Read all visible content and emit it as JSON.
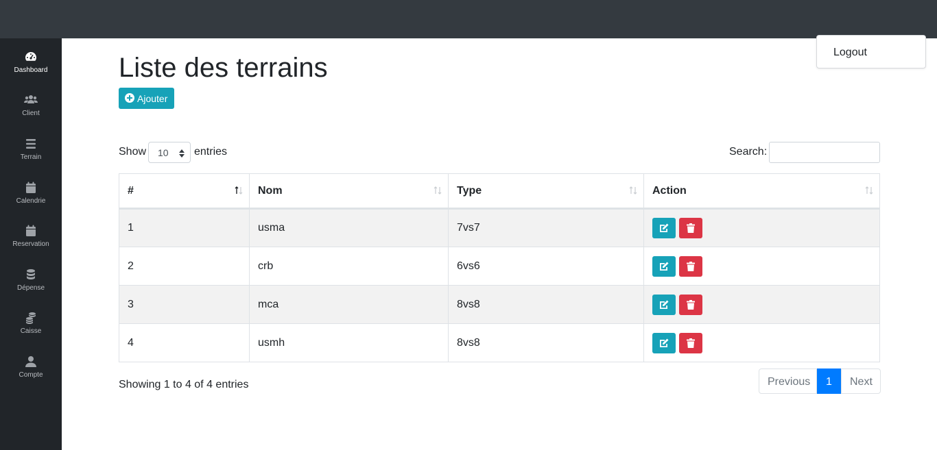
{
  "sidebar": {
    "items": [
      {
        "label": "Dashboard",
        "icon": "dashboard-icon"
      },
      {
        "label": "Client",
        "icon": "users-icon"
      },
      {
        "label": "Terrain",
        "icon": "bars-icon"
      },
      {
        "label": "Calendrie",
        "icon": "calendar-icon"
      },
      {
        "label": "Reservation",
        "icon": "calendar-icon"
      },
      {
        "label": "Dépense",
        "icon": "database-icon"
      },
      {
        "label": "Caisse",
        "icon": "coins-icon"
      },
      {
        "label": "Compte",
        "icon": "user-icon"
      }
    ]
  },
  "header": {
    "logout_label": "Logout"
  },
  "main": {
    "title": "Liste des terrains",
    "add_button_label": "Ajouter"
  },
  "table_controls": {
    "show_label": "Show",
    "page_length": "10",
    "entries_label": "entries",
    "search_label": "Search:",
    "search_value": ""
  },
  "table": {
    "columns": [
      "#",
      "Nom",
      "Type",
      "Action"
    ],
    "rows": [
      {
        "id": "1",
        "nom": "usma",
        "type": "7vs7"
      },
      {
        "id": "2",
        "nom": "crb",
        "type": "6vs6"
      },
      {
        "id": "3",
        "nom": "mca",
        "type": "8vs8"
      },
      {
        "id": "4",
        "nom": "usmh",
        "type": "8vs8"
      }
    ]
  },
  "footer": {
    "info": "Showing 1 to 4 of 4 entries",
    "prev_label": "Previous",
    "current_page": "1",
    "next_label": "Next"
  },
  "colors": {
    "topbar": "#343a40",
    "sidebar": "#212529",
    "info_button": "#17a2b8",
    "danger_button": "#dc3545",
    "primary": "#007bff"
  }
}
